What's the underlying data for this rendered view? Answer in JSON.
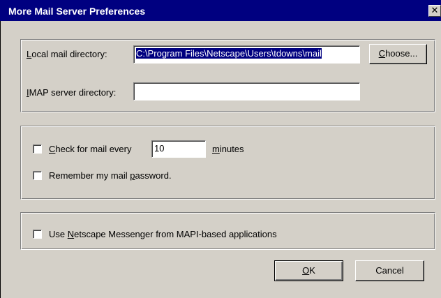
{
  "window": {
    "title": "More Mail Server Preferences",
    "close_glyph": "✕"
  },
  "directories": {
    "local_label_pre": "",
    "local_label_key": "L",
    "local_label_post": "ocal mail directory:",
    "local_value": "C:\\Program Files\\Netscape\\Users\\tdowns\\mail",
    "choose_pre": "",
    "choose_key": "C",
    "choose_post": "hoose...",
    "imap_label_key": "I",
    "imap_label_post": "MAP server directory:",
    "imap_value": ""
  },
  "checking": {
    "check_label_key": "C",
    "check_label_post": "heck for mail every",
    "check_checked": false,
    "interval_value": "10",
    "minutes_key": "m",
    "minutes_post": "inutes",
    "remember_pre": "Remember my mail ",
    "remember_key": "p",
    "remember_post": "assword.",
    "remember_checked": false
  },
  "mapi": {
    "label_pre": "Use ",
    "label_key": "N",
    "label_post": "etscape Messenger from MAPI-based applications",
    "checked": false
  },
  "buttons": {
    "ok_pre": "",
    "ok_key": "O",
    "ok_post": "K",
    "cancel": "Cancel"
  }
}
